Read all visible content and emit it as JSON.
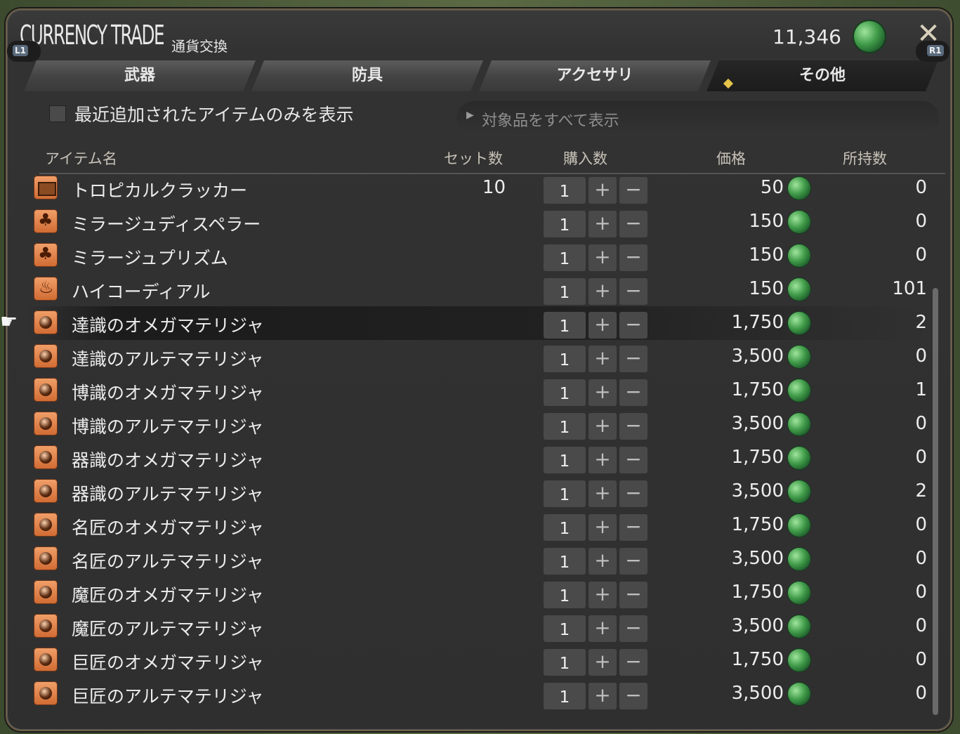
{
  "window": {
    "title_en": "CURRENCY TRADE",
    "title_jp": "通貨交換",
    "currency_amount": "11,346",
    "currency_icon": "green-gem-icon",
    "bumper_left": "L1",
    "bumper_right": "R1"
  },
  "tabs": [
    {
      "label": "武器",
      "active": false
    },
    {
      "label": "防具",
      "active": false
    },
    {
      "label": "アクセサリ",
      "active": false
    },
    {
      "label": "その他",
      "active": true
    }
  ],
  "filter": {
    "checkbox_label": "最近追加されたアイテムのみを表示",
    "checked": false,
    "dropdown_value": "対象品をすべて表示"
  },
  "columns": {
    "name": "アイテム名",
    "set": "セット数",
    "buy": "購入数",
    "price": "価格",
    "owned": "所持数"
  },
  "items": [
    {
      "name": "トロピカルクラッカー",
      "set": "10",
      "qty": "1",
      "price": "50",
      "owned": "0",
      "icon": "box"
    },
    {
      "name": "ミラージュディスペラー",
      "set": "",
      "qty": "1",
      "price": "150",
      "owned": "0",
      "icon": "leaf"
    },
    {
      "name": "ミラージュプリズム",
      "set": "",
      "qty": "1",
      "price": "150",
      "owned": "0",
      "icon": "leaf"
    },
    {
      "name": "ハイコーディアル",
      "set": "",
      "qty": "1",
      "price": "150",
      "owned": "101",
      "icon": "potion"
    },
    {
      "name": "達識のオメガマテリジャ",
      "set": "",
      "qty": "1",
      "price": "1,750",
      "owned": "2",
      "icon": "mat"
    },
    {
      "name": "達識のアルテマテリジャ",
      "set": "",
      "qty": "1",
      "price": "3,500",
      "owned": "0",
      "icon": "mat"
    },
    {
      "name": "博識のオメガマテリジャ",
      "set": "",
      "qty": "1",
      "price": "1,750",
      "owned": "1",
      "icon": "mat"
    },
    {
      "name": "博識のアルテマテリジャ",
      "set": "",
      "qty": "1",
      "price": "3,500",
      "owned": "0",
      "icon": "mat"
    },
    {
      "name": "器識のオメガマテリジャ",
      "set": "",
      "qty": "1",
      "price": "1,750",
      "owned": "0",
      "icon": "mat"
    },
    {
      "name": "器識のアルテマテリジャ",
      "set": "",
      "qty": "1",
      "price": "3,500",
      "owned": "2",
      "icon": "mat"
    },
    {
      "name": "名匠のオメガマテリジャ",
      "set": "",
      "qty": "1",
      "price": "1,750",
      "owned": "0",
      "icon": "mat"
    },
    {
      "name": "名匠のアルテマテリジャ",
      "set": "",
      "qty": "1",
      "price": "3,500",
      "owned": "0",
      "icon": "mat"
    },
    {
      "name": "魔匠のオメガマテリジャ",
      "set": "",
      "qty": "1",
      "price": "1,750",
      "owned": "0",
      "icon": "mat"
    },
    {
      "name": "魔匠のアルテマテリジャ",
      "set": "",
      "qty": "1",
      "price": "3,500",
      "owned": "0",
      "icon": "mat"
    },
    {
      "name": "巨匠のオメガマテリジャ",
      "set": "",
      "qty": "1",
      "price": "1,750",
      "owned": "0",
      "icon": "mat"
    },
    {
      "name": "巨匠のアルテマテリジャ",
      "set": "",
      "qty": "1",
      "price": "3,500",
      "owned": "0",
      "icon": "mat"
    }
  ],
  "selected_row": 4,
  "buttons": {
    "plus": "+",
    "minus": "−"
  }
}
